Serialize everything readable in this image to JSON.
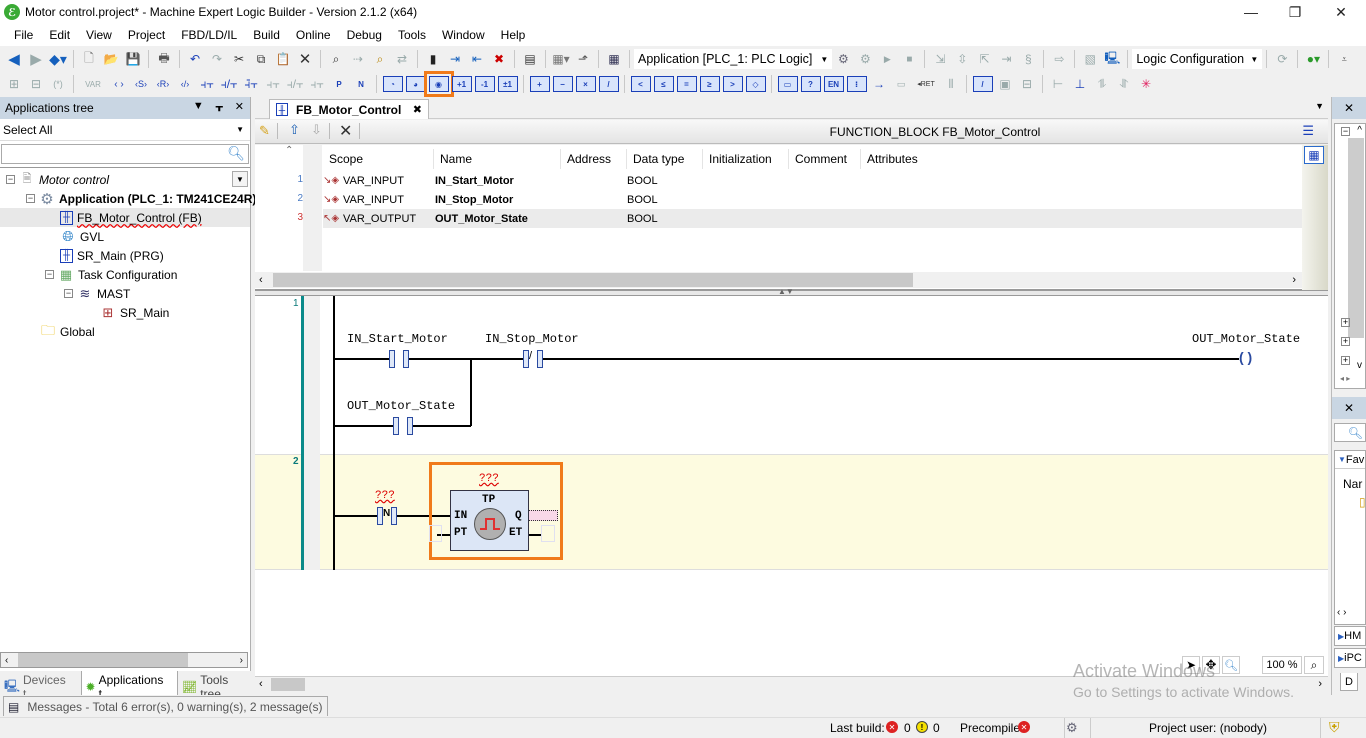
{
  "window": {
    "title": "Motor control.project* - Machine Expert Logic Builder - Version 2.1.2 (x64)",
    "minimize": "—",
    "restore": "❐",
    "close": "✕"
  },
  "menu": [
    "File",
    "Edit",
    "View",
    "Project",
    "FBD/LD/IL",
    "Build",
    "Online",
    "Debug",
    "Tools",
    "Window",
    "Help"
  ],
  "toolbar": {
    "application_combo": "Application [PLC_1: PLC Logic]",
    "logic_combo": "Logic Configuration"
  },
  "ladder_toolbar": {
    "var_label": "VAR",
    "selected_tool": "insert-timer-block"
  },
  "left_panel": {
    "title": "Applications tree",
    "filter": "Select All",
    "search_placeholder": "",
    "tree": [
      {
        "label": "Motor control",
        "level": 0,
        "italic": true,
        "icon": "project-icon"
      },
      {
        "label": "Application (PLC_1: TM241CE24R)",
        "level": 1,
        "bold": true,
        "icon": "gear-icon"
      },
      {
        "label": "FB_Motor_Control (FB)",
        "level": 2,
        "icon": "ladder-pou-icon",
        "selected": true
      },
      {
        "label": "GVL",
        "level": 2,
        "icon": "globe-icon"
      },
      {
        "label": "SR_Main (PRG)",
        "level": 2,
        "icon": "ladder-pou-icon"
      },
      {
        "label": "Task Configuration",
        "level": 2,
        "icon": "task-config-icon"
      },
      {
        "label": "MAST",
        "level": 3,
        "icon": "task-icon"
      },
      {
        "label": "SR_Main",
        "level": 4,
        "icon": "task-call-icon"
      },
      {
        "label": "Global",
        "level": 1,
        "icon": "folder-icon"
      }
    ],
    "bottom_tabs": [
      "Devices t...",
      "Applications t...",
      "Tools tree"
    ]
  },
  "editor": {
    "tab_label": "FB_Motor_Control",
    "header": "FUNCTION_BLOCK FB_Motor_Control",
    "columns": [
      "Scope",
      "Name",
      "Address",
      "Data type",
      "Initialization",
      "Comment",
      "Attributes"
    ],
    "variables": [
      {
        "num": "1",
        "scope": "VAR_INPUT",
        "name": "IN_Start_Motor",
        "address": "",
        "type": "BOOL",
        "init": "",
        "comment": "",
        "attributes": ""
      },
      {
        "num": "2",
        "scope": "VAR_INPUT",
        "name": "IN_Stop_Motor",
        "address": "",
        "type": "BOOL",
        "init": "",
        "comment": "",
        "attributes": ""
      },
      {
        "num": "3",
        "scope": "VAR_OUTPUT",
        "name": "OUT_Motor_State",
        "address": "",
        "type": "BOOL",
        "init": "",
        "comment": "",
        "attributes": ""
      }
    ]
  },
  "ladder": {
    "networks": [
      {
        "number": "1",
        "contacts": [
          {
            "label": "IN_Start_Motor",
            "type": "NO"
          },
          {
            "label": "IN_Stop_Motor",
            "type": "NC",
            "symbol": "/"
          },
          {
            "label": "OUT_Motor_State",
            "type": "NO"
          }
        ],
        "coil": {
          "label": "OUT_Motor_State"
        }
      },
      {
        "number": "2",
        "contact": {
          "label": "???",
          "symbol": "N"
        },
        "block": {
          "instance": "???",
          "type": "TP",
          "inputs": [
            "IN",
            "PT"
          ],
          "outputs": [
            "Q",
            "ET"
          ]
        }
      }
    ],
    "zoom": "100 %"
  },
  "right_panel": {
    "favorites": "Fav",
    "name_col": "Nar",
    "sections": [
      "HM",
      "iPC"
    ],
    "tab": "D"
  },
  "watermark": {
    "line1": "Activate Windows",
    "line2": "Go to Settings to activate Windows."
  },
  "messages": "Messages - Total 6 error(s), 0 warning(s), 2 message(s)",
  "status": {
    "last_build_label": "Last build:",
    "errors": "0",
    "warnings": "0",
    "precompile": "Precompile",
    "project_user": "Project user: (nobody)"
  }
}
